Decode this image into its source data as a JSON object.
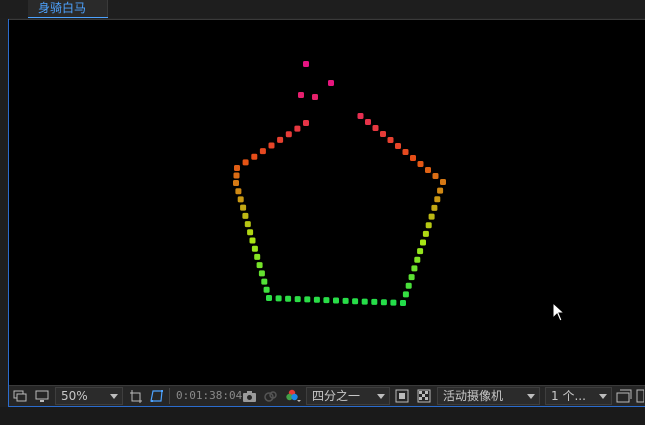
{
  "tab": {
    "title": "身骑白马"
  },
  "colors": {
    "accent": "#2b6ccd",
    "tab_text": "#4da3ff",
    "viewer_bg": "#000000"
  },
  "toolbar": {
    "zoom": "50%",
    "timecode": "0:01:38:04",
    "resolution": "四分之一",
    "camera": "活动摄像机",
    "views": "1 个..."
  },
  "icons": [
    "always-preview-icon",
    "monitor-icon",
    "region-of-interest-icon",
    "mask-toggle-icon",
    "snapshot-camera-icon",
    "show-snapshot-icon",
    "color-channel-icon",
    "fast-preview-icon",
    "transparency-grid-icon",
    "view-layout-icon",
    "reset-exposure-icon"
  ]
}
